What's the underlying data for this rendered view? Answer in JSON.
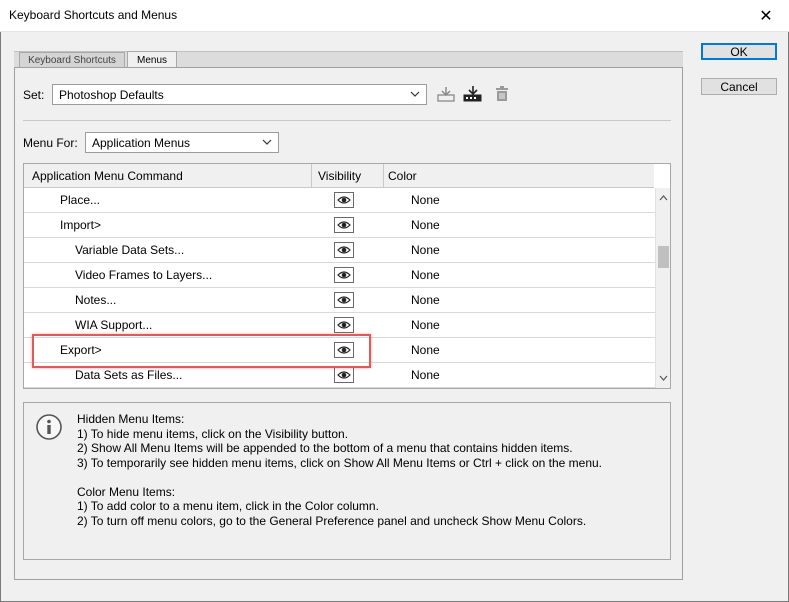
{
  "window": {
    "title": "Keyboard Shortcuts and Menus",
    "close_glyph": "✕"
  },
  "tabs": [
    {
      "label": "Keyboard Shortcuts",
      "active": false
    },
    {
      "label": "Menus",
      "active": true
    }
  ],
  "set": {
    "label": "Set:",
    "value": "Photoshop Defaults"
  },
  "set_icons": [
    "save-set-icon",
    "save-set-as-icon",
    "delete-set-icon"
  ],
  "menu_for": {
    "label": "Menu For:",
    "value": "Application Menus"
  },
  "table": {
    "headers": {
      "command": "Application Menu Command",
      "visibility": "Visibility",
      "color": "Color"
    },
    "rows": [
      {
        "command": "Place...",
        "indent": 1,
        "color": "None"
      },
      {
        "command": "Import>",
        "indent": 1,
        "color": "None"
      },
      {
        "command": "Variable Data Sets...",
        "indent": 2,
        "color": "None"
      },
      {
        "command": "Video Frames to Layers...",
        "indent": 2,
        "color": "None"
      },
      {
        "command": "Notes...",
        "indent": 2,
        "color": "None"
      },
      {
        "command": "WIA Support...",
        "indent": 2,
        "color": "None"
      },
      {
        "command": "Export>",
        "indent": 1,
        "color": "None"
      },
      {
        "command": "Data Sets as Files...",
        "indent": 2,
        "color": "None"
      }
    ]
  },
  "info": {
    "lines": [
      "Hidden Menu Items:",
      "1) To hide menu items, click on the Visibility button.",
      "2) Show All Menu Items will be appended to the bottom of a menu that contains hidden items.",
      "3) To temporarily see hidden menu items, click on Show All Menu Items or Ctrl + click on the menu.",
      "",
      "Color Menu Items:",
      "1) To add color to a menu item, click in the Color column.",
      "2) To turn off menu colors, go to the General Preference panel and uncheck Show Menu Colors."
    ]
  },
  "buttons": {
    "ok": "OK",
    "cancel": "Cancel"
  },
  "colors": {
    "highlight": "#e05a5a",
    "ok_border": "#0078d7"
  }
}
